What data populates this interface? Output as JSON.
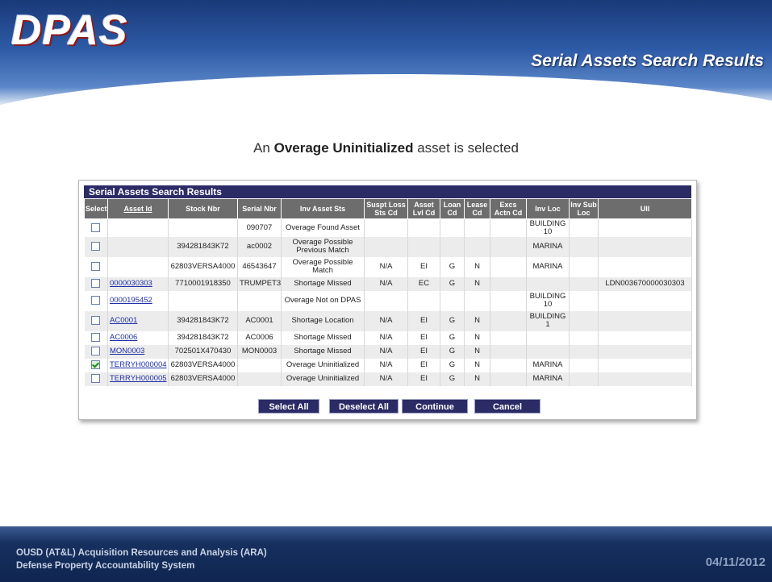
{
  "header": {
    "logo_text": "DPAS",
    "page_title": "Serial Assets Search Results"
  },
  "caption": {
    "prefix": "An ",
    "bold": "Overage Uninitialized",
    "suffix": " asset is selected"
  },
  "panel": {
    "title": "Serial Assets Search Results",
    "columns": [
      "Select",
      "Asset Id",
      "Stock Nbr",
      "Serial Nbr",
      "Inv Asset Sts",
      "Suspt Loss Sts Cd",
      "Asset Lvl Cd",
      "Loan Cd",
      "Lease Cd",
      "Excs Actn Cd",
      "Inv Loc",
      "Inv Sub Loc",
      "UII"
    ],
    "rows": [
      {
        "checked": false,
        "asset_id": "",
        "stock_nbr": "",
        "serial_nbr": "090707",
        "inv_asset_sts": "Overage Found Asset",
        "suspt_loss": "",
        "asset_lvl": "",
        "loan": "",
        "lease": "",
        "excs": "",
        "inv_loc": "BUILDING 10",
        "inv_sub_loc": "",
        "uii": ""
      },
      {
        "checked": false,
        "asset_id": "",
        "stock_nbr": "394281843K72",
        "serial_nbr": "ac0002",
        "inv_asset_sts": "Overage Possible Previous Match",
        "suspt_loss": "",
        "asset_lvl": "",
        "loan": "",
        "lease": "",
        "excs": "",
        "inv_loc": "MARINA",
        "inv_sub_loc": "",
        "uii": ""
      },
      {
        "checked": false,
        "asset_id": "",
        "stock_nbr": "62803VERSA4000",
        "serial_nbr": "46543647",
        "inv_asset_sts": "Overage Possible Match",
        "suspt_loss": "N/A",
        "asset_lvl": "EI",
        "loan": "G",
        "lease": "N",
        "excs": "",
        "inv_loc": "MARINA",
        "inv_sub_loc": "",
        "uii": ""
      },
      {
        "checked": false,
        "asset_id": "0000030303",
        "stock_nbr": "7710001918350",
        "serial_nbr": "TRUMPET3",
        "inv_asset_sts": "Shortage Missed",
        "suspt_loss": "N/A",
        "asset_lvl": "EC",
        "loan": "G",
        "lease": "N",
        "excs": "",
        "inv_loc": "",
        "inv_sub_loc": "",
        "uii": "LDN003670000030303"
      },
      {
        "checked": false,
        "asset_id": "0000195452",
        "stock_nbr": "",
        "serial_nbr": "",
        "inv_asset_sts": "Overage Not on DPAS",
        "suspt_loss": "",
        "asset_lvl": "",
        "loan": "",
        "lease": "",
        "excs": "",
        "inv_loc": "BUILDING 10",
        "inv_sub_loc": "",
        "uii": ""
      },
      {
        "checked": false,
        "asset_id": "AC0001",
        "stock_nbr": "394281843K72",
        "serial_nbr": "AC0001",
        "inv_asset_sts": "Shortage Location",
        "suspt_loss": "N/A",
        "asset_lvl": "EI",
        "loan": "G",
        "lease": "N",
        "excs": "",
        "inv_loc": "BUILDING 1",
        "inv_sub_loc": "",
        "uii": ""
      },
      {
        "checked": false,
        "asset_id": "AC0006",
        "stock_nbr": "394281843K72",
        "serial_nbr": "AC0006",
        "inv_asset_sts": "Shortage Missed",
        "suspt_loss": "N/A",
        "asset_lvl": "EI",
        "loan": "G",
        "lease": "N",
        "excs": "",
        "inv_loc": "",
        "inv_sub_loc": "",
        "uii": ""
      },
      {
        "checked": false,
        "asset_id": "MON0003",
        "stock_nbr": "702501X470430",
        "serial_nbr": "MON0003",
        "inv_asset_sts": "Shortage Missed",
        "suspt_loss": "N/A",
        "asset_lvl": "EI",
        "loan": "G",
        "lease": "N",
        "excs": "",
        "inv_loc": "",
        "inv_sub_loc": "",
        "uii": ""
      },
      {
        "checked": true,
        "asset_id": "TERRYH000004",
        "stock_nbr": "62803VERSA4000",
        "serial_nbr": "",
        "inv_asset_sts": "Overage Uninitialized",
        "suspt_loss": "N/A",
        "asset_lvl": "EI",
        "loan": "G",
        "lease": "N",
        "excs": "",
        "inv_loc": "MARINA",
        "inv_sub_loc": "",
        "uii": ""
      },
      {
        "checked": false,
        "asset_id": "TERRYH000005",
        "stock_nbr": "62803VERSA4000",
        "serial_nbr": "",
        "inv_asset_sts": "Overage Uninitialized",
        "suspt_loss": "N/A",
        "asset_lvl": "EI",
        "loan": "G",
        "lease": "N",
        "excs": "",
        "inv_loc": "MARINA",
        "inv_sub_loc": "",
        "uii": ""
      }
    ],
    "buttons": {
      "select_all": "Select All",
      "deselect_all": "Deselect All",
      "continue": "Continue",
      "cancel": "Cancel"
    }
  },
  "footer": {
    "org_line1": "OUSD (AT&L) Acquisition Resources and Analysis (ARA)",
    "org_line2": "Defense Property Accountability System",
    "date": "04/11/2012"
  }
}
